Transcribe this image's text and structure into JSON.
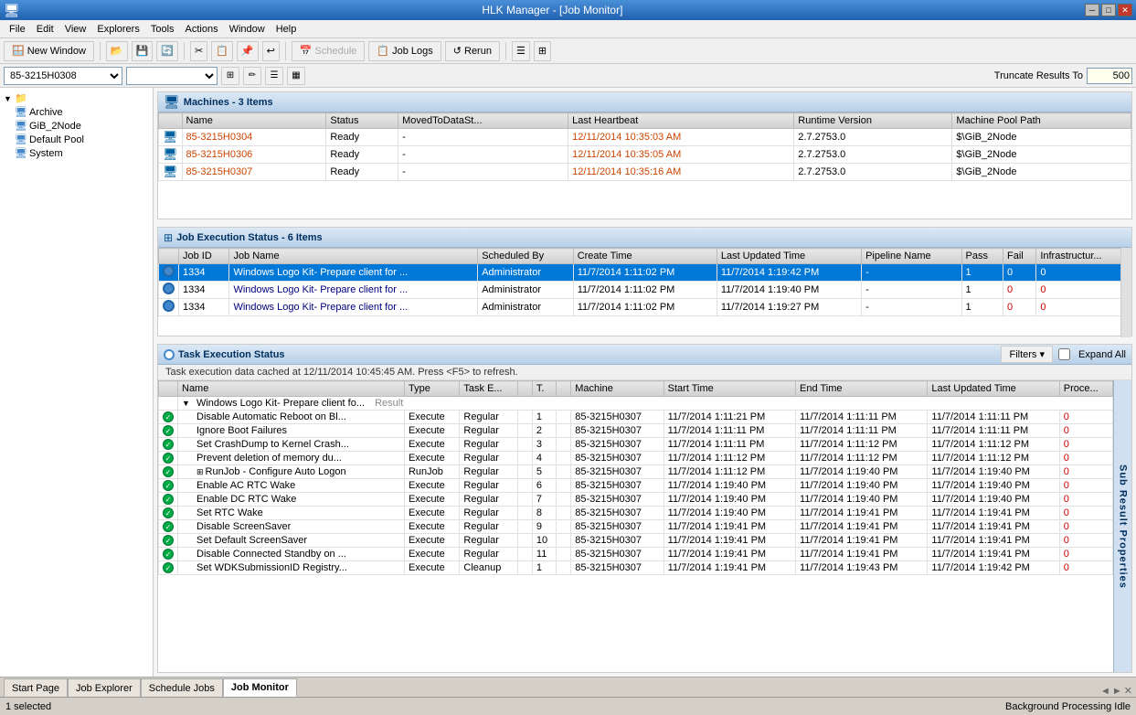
{
  "window": {
    "title": "HLK Manager - [Job Monitor]",
    "title_btn_min": "─",
    "title_btn_max": "□",
    "title_btn_close": "✕"
  },
  "menu": {
    "items": [
      "File",
      "Edit",
      "View",
      "Explorers",
      "Tools",
      "Actions",
      "Window",
      "Help"
    ]
  },
  "toolbar": {
    "new_window": "New Window",
    "schedule": "Schedule",
    "job_logs": "Job Logs",
    "rerun": "Rerun"
  },
  "addr_bar": {
    "machine_pool_value": "85-3215H0308",
    "truncate_label": "Truncate Results To",
    "truncate_value": "500"
  },
  "sidebar": {
    "root_label": "",
    "items": [
      {
        "label": "Archive",
        "indent": 1
      },
      {
        "label": "GiB_2Node",
        "indent": 1
      },
      {
        "label": "Default Pool",
        "indent": 1
      },
      {
        "label": "System",
        "indent": 1
      }
    ]
  },
  "machines": {
    "title": "Machines - 3 Items",
    "columns": [
      "Name",
      "Status",
      "MovedToDataSt...",
      "Last Heartbeat",
      "Runtime Version",
      "Machine Pool Path"
    ],
    "rows": [
      {
        "name": "85-3215H0304",
        "status": "Ready",
        "moved": "-",
        "heartbeat": "12/11/2014 10:35:03 AM",
        "runtime": "2.7.2753.0",
        "pool_path": "$\\GiB_2Node"
      },
      {
        "name": "85-3215H0306",
        "status": "Ready",
        "moved": "-",
        "heartbeat": "12/11/2014 10:35:05 AM",
        "runtime": "2.7.2753.0",
        "pool_path": "$\\GiB_2Node"
      },
      {
        "name": "85-3215H0307",
        "status": "Ready",
        "moved": "-",
        "heartbeat": "12/11/2014 10:35:16 AM",
        "runtime": "2.7.2753.0",
        "pool_path": "$\\GiB_2Node"
      }
    ]
  },
  "job_execution": {
    "title": "Job Execution Status - 6 Items",
    "columns": [
      "Job ID",
      "Job Name",
      "Scheduled By",
      "Create Time",
      "Last Updated Time",
      "Pipeline Name",
      "Pass",
      "Fail",
      "Infrastructur..."
    ],
    "rows": [
      {
        "id": "1334",
        "name": "Windows Logo Kit- Prepare client for ...",
        "scheduled_by": "Administrator",
        "create": "11/7/2014 1:11:02 PM",
        "updated": "11/7/2014 1:19:42 PM",
        "pipeline": "-",
        "pass": "1",
        "fail": "0",
        "infra": "0",
        "selected": true
      },
      {
        "id": "1334",
        "name": "Windows Logo Kit- Prepare client for ...",
        "scheduled_by": "Administrator",
        "create": "11/7/2014 1:11:02 PM",
        "updated": "11/7/2014 1:19:40 PM",
        "pipeline": "-",
        "pass": "1",
        "fail": "0",
        "infra": "0",
        "selected": false
      },
      {
        "id": "1334",
        "name": "Windows Logo Kit- Prepare client for ...",
        "scheduled_by": "Administrator",
        "create": "11/7/2014 1:11:02 PM",
        "updated": "11/7/2014 1:19:27 PM",
        "pipeline": "-",
        "pass": "1",
        "fail": "0",
        "infra": "0",
        "selected": false
      }
    ]
  },
  "task_execution": {
    "title": "Task Execution Status",
    "status_msg": "Task execution data cached at 12/11/2014 10:45:45 AM. Press <F5> to refresh.",
    "filters_label": "Filters ▾",
    "expand_all_label": "Expand All",
    "columns": [
      "Name",
      "Type",
      "Task E...",
      "",
      "T.",
      "",
      "Machine",
      "Start Time",
      "End Time",
      "Last Updated Time",
      "Proce..."
    ],
    "parent_row": {
      "name": "Windows Logo Kit- Prepare client fo...",
      "type": "Result"
    },
    "rows": [
      {
        "status": "ok",
        "name": "Disable Automatic Reboot on Bl...",
        "type": "Execute",
        "task_type": "Regular",
        "task_e": "1",
        "machine": "85-3215H0307",
        "start": "11/7/2014 1:11:21 PM",
        "end": "11/7/2014 1:11:11 PM",
        "updated": "11/7/2014 1:11:11 PM",
        "proc": "0"
      },
      {
        "status": "ok",
        "name": "Ignore Boot Failures",
        "type": "Execute",
        "task_type": "Regular",
        "task_e": "2",
        "machine": "85-3215H0307",
        "start": "11/7/2014 1:11:11 PM",
        "end": "11/7/2014 1:11:11 PM",
        "updated": "11/7/2014 1:11:11 PM",
        "proc": "0"
      },
      {
        "status": "ok",
        "name": "Set CrashDump to Kernel Crash...",
        "type": "Execute",
        "task_type": "Regular",
        "task_e": "3",
        "machine": "85-3215H0307",
        "start": "11/7/2014 1:11:11 PM",
        "end": "11/7/2014 1:11:12 PM",
        "updated": "11/7/2014 1:11:12 PM",
        "proc": "0"
      },
      {
        "status": "ok",
        "name": "Prevent deletion of memory du...",
        "type": "Execute",
        "task_type": "Regular",
        "task_e": "4",
        "machine": "85-3215H0307",
        "start": "11/7/2014 1:11:12 PM",
        "end": "11/7/2014 1:11:12 PM",
        "updated": "11/7/2014 1:11:12 PM",
        "proc": "0"
      },
      {
        "status": "ok",
        "name": "RunJob - Configure Auto Logon",
        "type": "RunJob",
        "task_type": "Regular",
        "task_e": "5",
        "machine": "85-3215H0307",
        "start": "11/7/2014 1:11:12 PM",
        "end": "11/7/2014 1:19:40 PM",
        "updated": "11/7/2014 1:19:40 PM",
        "proc": "0",
        "has_expand": true
      },
      {
        "status": "ok",
        "name": "Enable AC RTC Wake",
        "type": "Execute",
        "task_type": "Regular",
        "task_e": "6",
        "machine": "85-3215H0307",
        "start": "11/7/2014 1:19:40 PM",
        "end": "11/7/2014 1:19:40 PM",
        "updated": "11/7/2014 1:19:40 PM",
        "proc": "0"
      },
      {
        "status": "ok",
        "name": "Enable DC RTC Wake",
        "type": "Execute",
        "task_type": "Regular",
        "task_e": "7",
        "machine": "85-3215H0307",
        "start": "11/7/2014 1:19:40 PM",
        "end": "11/7/2014 1:19:40 PM",
        "updated": "11/7/2014 1:19:40 PM",
        "proc": "0"
      },
      {
        "status": "ok",
        "name": "Set RTC Wake",
        "type": "Execute",
        "task_type": "Regular",
        "task_e": "8",
        "machine": "85-3215H0307",
        "start": "11/7/2014 1:19:40 PM",
        "end": "11/7/2014 1:19:41 PM",
        "updated": "11/7/2014 1:19:41 PM",
        "proc": "0"
      },
      {
        "status": "ok",
        "name": "Disable ScreenSaver",
        "type": "Execute",
        "task_type": "Regular",
        "task_e": "9",
        "machine": "85-3215H0307",
        "start": "11/7/2014 1:19:41 PM",
        "end": "11/7/2014 1:19:41 PM",
        "updated": "11/7/2014 1:19:41 PM",
        "proc": "0"
      },
      {
        "status": "ok",
        "name": "Set Default ScreenSaver",
        "type": "Execute",
        "task_type": "Regular",
        "task_e": "10",
        "machine": "85-3215H0307",
        "start": "11/7/2014 1:19:41 PM",
        "end": "11/7/2014 1:19:41 PM",
        "updated": "11/7/2014 1:19:41 PM",
        "proc": "0"
      },
      {
        "status": "ok",
        "name": "Disable Connected Standby on ...",
        "type": "Execute",
        "task_type": "Regular",
        "task_e": "11",
        "machine": "85-3215H0307",
        "start": "11/7/2014 1:19:41 PM",
        "end": "11/7/2014 1:19:41 PM",
        "updated": "11/7/2014 1:19:41 PM",
        "proc": "0"
      },
      {
        "status": "ok",
        "name": "Set WDKSubmissionID Registry...",
        "type": "Execute",
        "task_type": "Cleanup",
        "task_e": "1",
        "machine": "85-3215H0307",
        "start": "11/7/2014 1:19:41 PM",
        "end": "11/7/2014 1:19:43 PM",
        "updated": "11/7/2014 1:19:42 PM",
        "proc": "0"
      }
    ]
  },
  "tabs": {
    "items": [
      "Start Page",
      "Job Explorer",
      "Schedule Jobs",
      "Job Monitor"
    ]
  },
  "status_bar": {
    "left": "1 selected",
    "right": "Background Processing Idle"
  }
}
